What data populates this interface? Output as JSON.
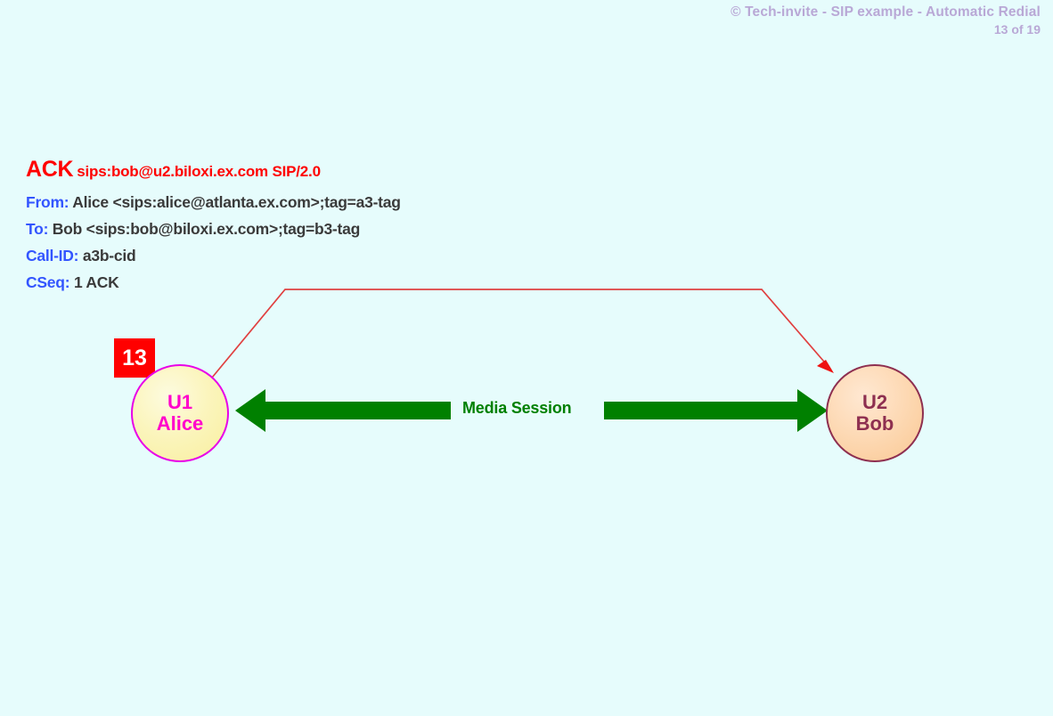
{
  "header": {
    "title": "© Tech-invite - SIP example - Automatic Redial",
    "page": "13 of 19"
  },
  "sip_message": {
    "request_method": "ACK",
    "request_uri": "sips:bob@u2.biloxi.ex.com SIP/2.0",
    "headers": [
      {
        "name": "From:",
        "value": "Alice <sips:alice@atlanta.ex.com>;tag=a3-tag"
      },
      {
        "name": "To:",
        "value": "Bob <sips:bob@biloxi.ex.com>;tag=b3-tag"
      },
      {
        "name": "Call-ID:",
        "value": "a3b-cid"
      },
      {
        "name": "CSeq:",
        "value": "1 ACK"
      }
    ]
  },
  "step_badge": {
    "number": "13"
  },
  "endpoints": [
    {
      "id": "alice",
      "line1": "U1",
      "line2": "Alice"
    },
    {
      "id": "bob",
      "line1": "U2",
      "line2": "Bob"
    }
  ],
  "media": {
    "label": "Media Session"
  },
  "colors": {
    "background": "#e6fcfc",
    "request_red": "#ff0000",
    "header_blue": "#3355ff",
    "header_value_gray": "#3a3a3a",
    "title_lavender": "#b9a8d6",
    "badge_red": "#ff0000",
    "alice_border_magenta": "#e800e8",
    "alice_text_magenta": "#ff00cc",
    "alice_fill_yellow": "#fbf5bd",
    "bob_border_maroon": "#8e2f50",
    "bob_fill_peach": "#fdd9b4",
    "media_green": "#008000",
    "signal_arrow_red": "#e04040"
  }
}
